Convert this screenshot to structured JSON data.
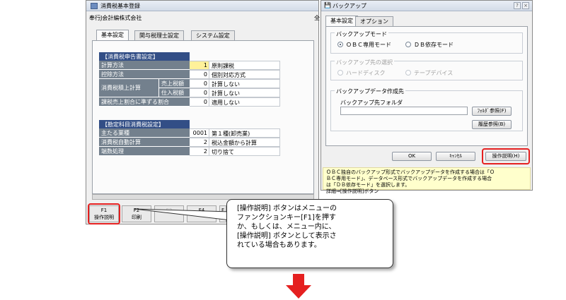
{
  "left_window": {
    "title": "消費税基本登録",
    "company": "奉行J会計編株式会社",
    "company_suffix": "全",
    "tabs": [
      "基本設定",
      "関与税理士設定",
      "システム設定"
    ],
    "section1": {
      "header": "【消費税申告書設定】",
      "rows": [
        {
          "label": "計算方法",
          "num": "1",
          "value": "原則課税"
        },
        {
          "label": "控除方法",
          "num": "0",
          "value": "個別対応方式"
        },
        {
          "label": "消費税積上計算",
          "sub": "売上税額",
          "num": "0",
          "value": "計算しない"
        },
        {
          "label": "",
          "sub": "仕入税額",
          "num": "0",
          "value": "計算しない"
        },
        {
          "label": "課税売上割合に準ずる割合",
          "num": "0",
          "value": "適用しない"
        }
      ]
    },
    "section2": {
      "header": "【勘定科目消費税設定】",
      "rows": [
        {
          "label": "主たる業種",
          "num": "0001",
          "value": "第１種(卸売業)"
        },
        {
          "label": "消費税自動計算",
          "num": "2",
          "value": "税込金額から計算"
        },
        {
          "label": "端数処理",
          "num": "2",
          "value": "切り捨て"
        }
      ]
    },
    "fkeys": [
      {
        "key": "F1",
        "label": "操作説明"
      },
      {
        "key": "F2",
        "label": "印刷"
      },
      {
        "key": "F3",
        "label": ""
      },
      {
        "key": "F4",
        "label": ""
      },
      {
        "key": "F",
        "label": ""
      }
    ]
  },
  "right_window": {
    "title": "バックアップ",
    "tabs": [
      "基本設定",
      "オプション"
    ],
    "mode_group": {
      "label": "バックアップモード",
      "options": [
        "ＯＢＣ専用モード",
        "ＤＢ依存モード"
      ]
    },
    "dest_group": {
      "label": "バックアップ先の選択",
      "options": [
        "ハードディスク",
        "テープデバイス"
      ]
    },
    "data_group": {
      "label": "バックアップデータ作成先",
      "folder_label": "バックアップ先フォルダ",
      "browse_button": "ﾌｫﾙﾀﾞ参照(F)",
      "history_button": "履歴参照(B)"
    },
    "ok_button": "OK",
    "cancel_button": "ｷｬﾝｾﾙ",
    "help_button": "操作説明(H)",
    "help_text": [
      "ＯＢＣ独自のバックアップ形式でバックアップデータを作成する場合は「Ｏ",
      "ＢＣ専用モード」、データベース形式でバックアップデータを作成する場合",
      "は「ＤＢ依存モード」を選択します。",
      "詳細⇒[操作説明]ボタン"
    ]
  },
  "callout": {
    "lines": [
      "[操作説明] ボタンはメニューの",
      "ファンクションキー[F1]を押す",
      "か、もしくは、メニュー内に、",
      "[操作説明] ボタンとして表示さ",
      "れている場合もあります。"
    ]
  },
  "colors": {
    "header_blue": "#324e86",
    "label_gray": "#73808d",
    "highlight_yellow": "#fff19a",
    "red": "#e52020",
    "help_bg": "#ffffcc"
  }
}
